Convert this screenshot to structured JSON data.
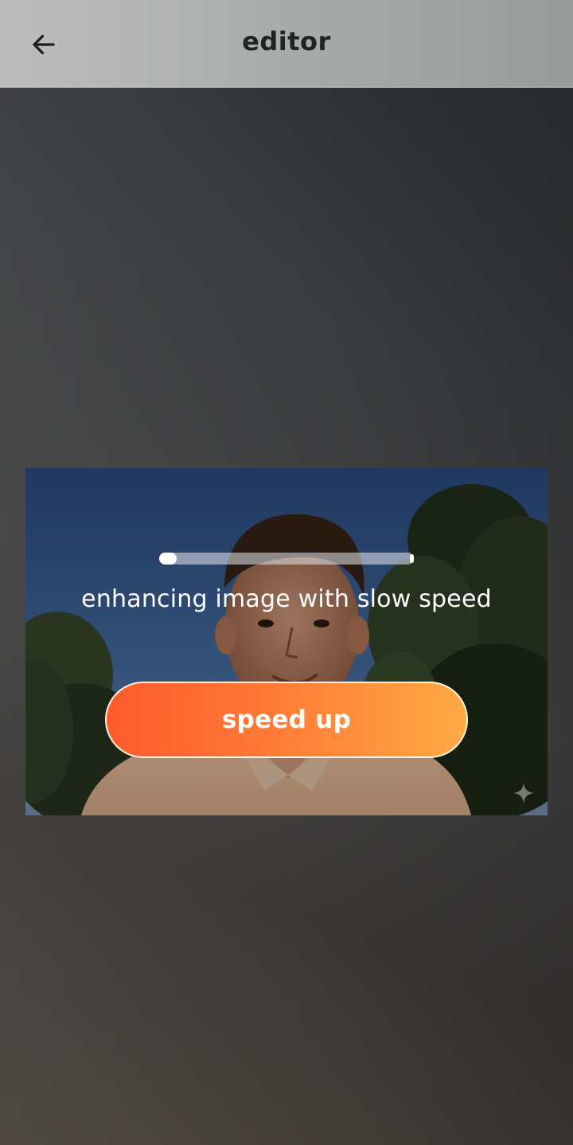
{
  "header": {
    "title": "editor",
    "back_icon": "arrow-left-icon"
  },
  "editor": {
    "progress_fraction": 0.07,
    "status_text": "enhancing image with slow speed",
    "speed_up_label": "speed up",
    "watermark_icon": "sparkle-icon"
  },
  "colors": {
    "button_gradient_start": "#ff5a2c",
    "button_gradient_end": "#ffaa45",
    "header_bg": "#b0b2b2",
    "title_color": "#202224"
  }
}
